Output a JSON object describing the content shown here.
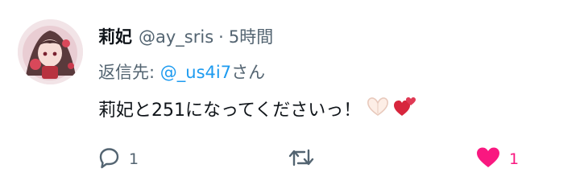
{
  "tweet": {
    "display_name": "莉妃",
    "handle": "@ay_sris",
    "separator": "·",
    "time": "5時間",
    "reply_prefix": "返信先: ",
    "reply_to_handle": "@_us4i7",
    "reply_suffix": "さん",
    "body": "莉妃と251になってくださいっ！",
    "emojis": [
      "heart-hands-emoji",
      "two-hearts-emoji"
    ]
  },
  "actions": {
    "reply_count": "1",
    "retweet_count": "",
    "like_count": "1",
    "like_active": true
  },
  "colors": {
    "primary_text": "#0f1419",
    "secondary_text": "#536471",
    "link": "#1d9bf0",
    "like": "#f91880"
  },
  "icons": {
    "reply": "speech-bubble-icon",
    "retweet": "retweet-icon",
    "like": "heart-icon"
  }
}
